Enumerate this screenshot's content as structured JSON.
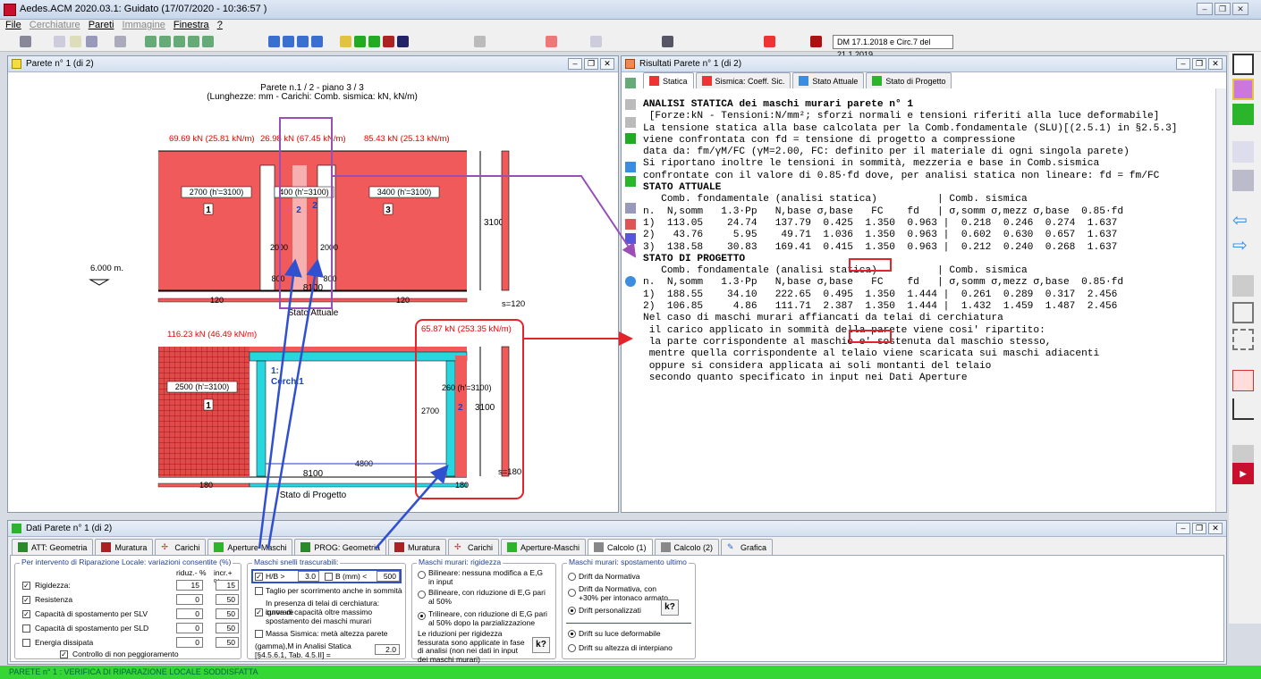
{
  "app": {
    "title": "Aedes.ACM 2020.03.1: Guidato  (17/07/2020 - 10:36:57 )",
    "norm": "DM 17.1.2018 e Circ.7 del 21.1.2019"
  },
  "menu": [
    "File",
    "Cerchiature",
    "Pareti",
    "Immagine",
    "Finestra",
    "?"
  ],
  "drawing_win": {
    "title": "Parete n° 1  (di 2)",
    "heading1": "Parete n.1 / 2 - piano 3 / 3",
    "heading2": "(Lunghezze: mm - Carichi: Comb. sismica: kN, kN/m)",
    "loads_top": [
      "69.69 kN (25.81 kN/m)",
      "26.98 kN (67.45 kN/m)",
      "85.43 kN (25.13 kN/m)"
    ],
    "dims_top": [
      "2700 (h'=3100)",
      "400 (h'=3100)",
      "3400 (h'=3100)"
    ],
    "pier_nums": [
      "1",
      "2",
      "2",
      "3"
    ],
    "dim2000": "2000",
    "dim800": "800",
    "height": "3100",
    "total": "8100",
    "s120": "s=120",
    "v120": "120",
    "elev": "6.000 m.",
    "state1": "Stato Attuale",
    "loads_bot": [
      "116.23 kN (46.49 kN/m)",
      "65.87 kN (253.35 kN/m)"
    ],
    "dims_bot": [
      "2500 (h'=3100)",
      "260 (h'=3100)"
    ],
    "cerch": "1:",
    "cerch2": "Cerch.1",
    "dim2700": "2700",
    "dim4800": "4800",
    "s180": "s=180",
    "v180": "180",
    "state2": "Stato di Progetto"
  },
  "results_win": {
    "title": "Risultati Parete n° 1  (di 2)",
    "tabs": [
      "Statica",
      "Sismica: Coeff. Sic.",
      "Stato Attuale",
      "Stato di Progetto"
    ],
    "lines": [
      "ANALISI STATICA dei maschi murari parete n° 1",
      " [Forze:kN - Tensioni:N/mm²; sforzi normali e tensioni riferiti alla luce deformabile]",
      "",
      "La tensione statica alla base calcolata per la Comb.fondamentale (SLU)[(2.5.1) in §2.5.3]",
      "viene confrontata con fd = tensione di progetto a compressione",
      "data da: fm/γM/FC (γM=2.00, FC: definito per il materiale di ogni singola parete)",
      "Si riportano inoltre le tensioni in sommità, mezzeria e base in Comb.sismica",
      "confrontate con il valore di 0.85·fd dove, per analisi statica non lineare: fd = fm/FC",
      "",
      "STATO ATTUALE",
      "   Comb. fondamentale (analisi statica)          | Comb. sismica",
      "n.  N,somm   1.3·Pp   N,base σ,base   FC    fd   | σ,somm σ,mezz σ,base  0.85·fd",
      "1)  113.05    24.74   137.79  0.425  1.350  0.963 |  0.218  0.246  0.274  1.637",
      "2)   43.76     5.95    49.71  1.036  1.350  0.963 |  0.602  0.630  0.657  1.637",
      "3)  138.58    30.83   169.41  0.415  1.350  0.963 |  0.212  0.240  0.268  1.637",
      "",
      "STATO DI PROGETTO",
      "   Comb. fondamentale (analisi statica)          | Comb. sismica",
      "n.  N,somm   1.3·Pp   N,base σ,base   FC    fd   | σ,somm σ,mezz σ,base  0.85·fd",
      "1)  188.55    34.10   222.65  0.495  1.350  1.444 |  0.261  0.289  0.317  2.456",
      "2)  106.85     4.86   111.71  2.387  1.350  1.444 |  1.432  1.459  1.487  2.456",
      "",
      "Nel caso di maschi murari affiancati da telai di cerchiatura",
      " il carico applicato in sommità della parete viene cosi' ripartito:",
      " la parte corrispondente al maschio e' sostenuta dal maschio stesso,",
      " mentre quella corrispondente al telaio viene scaricata sui maschi adiacenti",
      " oppure si considera applicata ai soli montanti del telaio",
      " secondo quanto specificato in input nei Dati Aperture"
    ]
  },
  "data_win": {
    "title": "Dati Parete n° 1  (di 2)",
    "tabs": [
      "ATT: Geometria",
      "Muratura",
      "Carichi",
      "Aperture-Maschi",
      "PROG: Geometria",
      "Muratura",
      "Carichi",
      "Aperture-Maschi",
      "Calcolo (1)",
      "Calcolo (2)",
      "Grafica"
    ],
    "g1": {
      "title": "Per intervento di Riparazione Locale: variazioni consentite (%)",
      "h1": "riduz.- %",
      "h2": "incr.+ %",
      "rows": [
        {
          "label": "Rigidezza:",
          "a": "15",
          "b": "15",
          "checked": true
        },
        {
          "label": "Resistenza",
          "a": "0",
          "b": "50",
          "checked": true
        },
        {
          "label": "Capacità di spostamento per SLV",
          "a": "0",
          "b": "50",
          "checked": true
        },
        {
          "label": "Capacità di spostamento per SLD",
          "a": "0",
          "b": "50",
          "checked": false
        },
        {
          "label": "Energia dissipata",
          "a": "0",
          "b": "50",
          "checked": false
        }
      ],
      "ctrl": "Controllo di non peggioramento"
    },
    "g2": {
      "title": "Maschi snelli trascurabili:",
      "hb": "H/B >",
      "hb_val": "3.0",
      "b": "B (mm) <",
      "b_val": "500",
      "taglio": "Taglio per scorrimento anche in sommità",
      "telai": "In presenza di telai di cerchiatura: ignorare",
      "curva": "curva di capacità oltre massimo spostamento dei maschi murari",
      "massa": "Massa Sismica: metà altezza parete",
      "gamma": "(gamma),M in Analisi Statica [§4.5.6.1, Tab. 4.5.II] =",
      "gamma_val": "2.0"
    },
    "g3": {
      "title": "Maschi murari: rigidezza",
      "o1": "Bilineare: nessuna modifica a E,G in input",
      "o2": "Bilineare, con riduzione di E,G pari al 50%",
      "o3": "Trilineare, con riduzione di E,G pari al 50% dopo la parzializzazione",
      "note": "Le riduzioni per rigidezza fessurata sono applicate in fase di analisi (non nei dati in input dei maschi murari)"
    },
    "g4": {
      "title": "Maschi murari: spostamento ultimo",
      "o1": "Drift da Normativa",
      "o2": "Drift da Normativa, con +30% per intonaco armato",
      "o3": "Drift personalizzati",
      "o4": "Drift su luce deformabile",
      "o5": "Drift su altezza di interpiano"
    }
  },
  "status": "PARETE n° 1 : VERIFICA DI RIPARAZIONE LOCALE SODDISFATTA"
}
